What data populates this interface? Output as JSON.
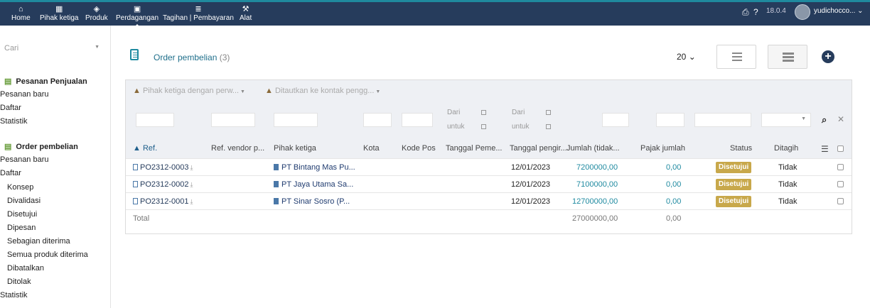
{
  "topnav": {
    "items": [
      {
        "label": "Home",
        "icon": "home-icon"
      },
      {
        "label": "Pihak ketiga",
        "icon": "building-icon"
      },
      {
        "label": "Produk",
        "icon": "cube-icon"
      },
      {
        "label": "Perdagangan",
        "icon": "briefcase-icon"
      },
      {
        "label": "Tagihan | Pembayaran",
        "icon": "invoice-icon"
      },
      {
        "label": "Alat",
        "icon": "wrench-icon"
      }
    ],
    "version": "18.0.4",
    "user": "yudichocco..."
  },
  "sidebar": {
    "search_placeholder": "Cari",
    "sales_title": "Pesanan Penjualan",
    "sales_items": [
      "Pesanan baru",
      "Daftar",
      "Statistik"
    ],
    "purchase_title": "Order pembelian",
    "purchase_items": [
      "Pesanan baru",
      "Daftar"
    ],
    "purchase_subitems": [
      "Konsep",
      "Divalidasi",
      "Disetujui",
      "Dipesan",
      "Sebagian diterima",
      "Semua produk diterima",
      "Dibatalkan",
      "Ditolak"
    ],
    "purchase_stats": "Statistik"
  },
  "page": {
    "title": "Order pembelian",
    "count": "(3)",
    "limit": "20"
  },
  "filters": {
    "thirdparty_placeholder": "Pihak ketiga dengan perw...",
    "contact_placeholder": "Ditautkan ke kontak pengg...",
    "date_from": "Dari",
    "date_to": "untuk"
  },
  "columns": [
    "Ref.",
    "Ref. vendor p...",
    "Pihak ketiga",
    "Kota",
    "Kode Pos",
    "Tanggal Peme...",
    "Tanggal pengir...",
    "Jumlah (tidak...",
    "Pajak jumlah",
    "Status",
    "Ditagih"
  ],
  "rows": [
    {
      "ref": "PO2312-0003",
      "thirdparty": "PT Bintang Mas Pu...",
      "delivery_date": "12/01/2023",
      "amount": "7200000,00",
      "tax": "0,00",
      "status": "Disetujui",
      "billed": "Tidak"
    },
    {
      "ref": "PO2312-0002",
      "thirdparty": "PT Jaya Utama Sa...",
      "delivery_date": "12/01/2023",
      "amount": "7100000,00",
      "tax": "0,00",
      "status": "Disetujui",
      "billed": "Tidak"
    },
    {
      "ref": "PO2312-0001",
      "thirdparty": "PT Sinar Sosro (P...",
      "delivery_date": "12/01/2023",
      "amount": "12700000,00",
      "tax": "0,00",
      "status": "Disetujui",
      "billed": "Tidak"
    }
  ],
  "totals": {
    "label": "Total",
    "amount": "27000000,00",
    "tax": "0,00"
  },
  "colors": {
    "navbar": "#263c5c",
    "accent": "#1f8aa0",
    "status_badge": "#c8a84b"
  }
}
